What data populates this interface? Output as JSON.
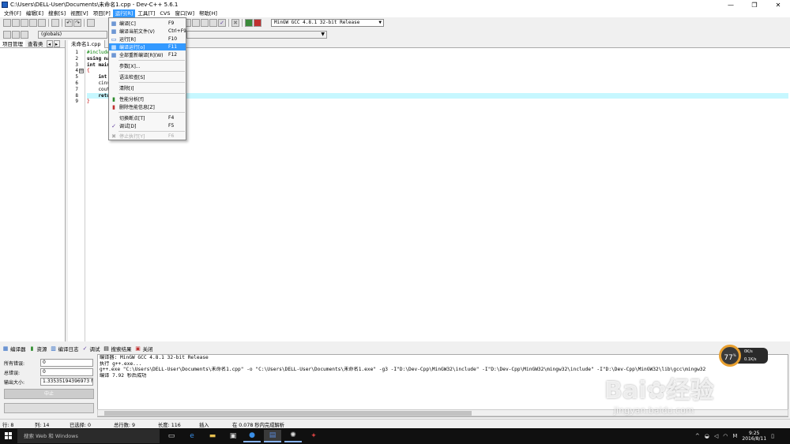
{
  "window": {
    "title": "C:\\Users\\DELL-User\\Documents\\未命名1.cpp - Dev-C++ 5.6.1",
    "minimize_icon": "minimize-icon",
    "maximize_icon": "maximize-icon",
    "close_icon": "close-icon"
  },
  "menubar": {
    "items": [
      "文件[F]",
      "编辑[E]",
      "搜索[S]",
      "视图[V]",
      "项目[P]",
      "运行[R]",
      "工具[T]",
      "CVS",
      "窗口[W]",
      "帮助[H]"
    ],
    "active_index": 5
  },
  "toolbar": {
    "compiler": "MinGW GCC 4.8.1 32-bit Release",
    "class_scope": "(globals)",
    "function_scope": ""
  },
  "left_panel": {
    "tabs": [
      "项目管理",
      "查看类"
    ]
  },
  "editor": {
    "tab": "未命名1.cpp",
    "line_numbers": [
      "1",
      "2",
      "3",
      "4",
      "5",
      "6",
      "7",
      "8",
      "9"
    ],
    "fold_symbol": "⊟",
    "lines": [
      "#include",
      "using na",
      "int main",
      "{",
      "    int ",
      "    cin>",
      "    cout",
      "    retu",
      "}"
    ],
    "highlight_line": 8
  },
  "run_menu": {
    "items": [
      {
        "icon": "compile-icon",
        "label": "编译[C]",
        "key": "F9"
      },
      {
        "icon": "compile-file-icon",
        "label": "编译当前文件(V)",
        "key": "Ctrl+F9"
      },
      {
        "icon": "run-icon",
        "label": "运行[R]",
        "key": "F10"
      },
      {
        "icon": "compile-run-icon",
        "label": "编译运行[o]",
        "key": "F11"
      },
      {
        "icon": "rebuild-all-icon",
        "label": "全部重新编译[R](W)",
        "key": "F12"
      },
      {
        "label": "参数[X]...",
        "key": ""
      },
      {
        "label": "语法检查[S]",
        "key": ""
      },
      {
        "label": "清除[I]",
        "key": ""
      },
      {
        "icon": "profile-icon",
        "label": "性能分析[f]",
        "key": ""
      },
      {
        "icon": "delete-profile-icon",
        "label": "删除性能信息[Z]",
        "key": ""
      },
      {
        "label": "切换断点[T]",
        "key": "F4"
      },
      {
        "icon": "debug-check-icon",
        "label": "调试[D]",
        "key": "F5"
      },
      {
        "icon": "stop-icon",
        "label": "停止执行[Y]",
        "key": "F6"
      }
    ],
    "selected_index": 3
  },
  "bottom_tabs": [
    {
      "icon": "compiler-grid-icon",
      "label": "编译器"
    },
    {
      "icon": "resources-icon",
      "label": "资源"
    },
    {
      "icon": "compile-log-icon",
      "label": "编译日志"
    },
    {
      "icon": "debug-check-icon",
      "label": "调试"
    },
    {
      "icon": "search-results-icon",
      "label": "搜索结果"
    },
    {
      "icon": "close-tab-icon",
      "label": "关闭"
    }
  ],
  "compile_stats": {
    "errors_label": "所有错误:",
    "errors_value": "0",
    "warnings_label": "总错误:",
    "warnings_value": "0",
    "output_size_label": "输出大小:",
    "output_size_value": "1.33535194396973 MiB",
    "abort_button": "中止"
  },
  "log": {
    "lines": [
      "编译器: MinGW GCC 4.8.1 32-bit Release",
      "执行 g++.exe...",
      "g++.exe \"C:\\Users\\DELL-User\\Documents\\未命名1.cpp\" -o \"C:\\Users\\DELL-User\\Documents\\未命名1.exe\" -g3 -I\"D:\\Dev-Cpp\\MinGW32\\include\" -I\"D:\\Dev-Cpp\\MinGW32\\mingw32\\include\" -I\"D:\\Dev-Cpp\\MinGW32\\lib\\gcc\\mingw32",
      "编译 7.92 秒后成功"
    ]
  },
  "statusbar": {
    "row": "行:     8",
    "col": "列:     14",
    "selected": "已选择:     0",
    "total_lines": "总行数:     9",
    "length": "长度:     116",
    "mode": "插入",
    "parse": "在 0.078 秒内完成解析"
  },
  "speed_widget": {
    "percent": "77",
    "unit": "%",
    "up": "0K/s",
    "down": "0.1K/s"
  },
  "watermark": {
    "brand": "Bai",
    "brand2": "经验",
    "url": "jingyan.baidu.com"
  },
  "taskbar": {
    "search_placeholder": "搜索 Web 和 Windows",
    "time": "9:25",
    "date": "2016/8/11",
    "ime": "M"
  }
}
